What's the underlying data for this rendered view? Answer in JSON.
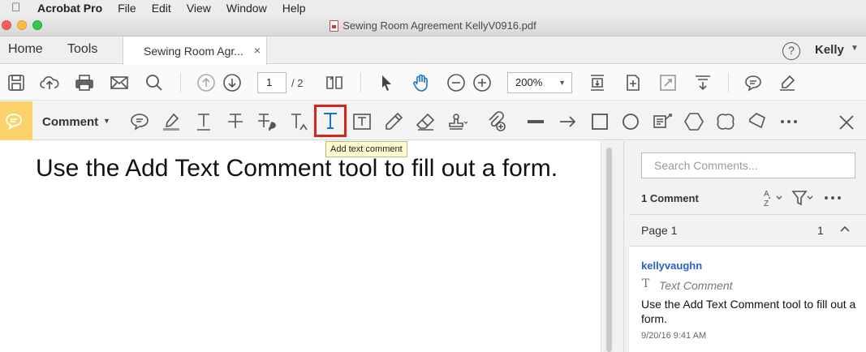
{
  "menubar": {
    "app": "Acrobat Pro",
    "items": [
      "File",
      "Edit",
      "View",
      "Window",
      "Help"
    ]
  },
  "window": {
    "title": "Sewing Room Agreement KellyV0916.pdf"
  },
  "tabs": {
    "home": "Home",
    "tools": "Tools",
    "document": "Sewing Room Agr...",
    "close": "×"
  },
  "user": {
    "name": "Kelly",
    "help": "?"
  },
  "toolbar": {
    "page_current": "1",
    "page_total": "/ 2",
    "zoom": "200%"
  },
  "comment_toolbar": {
    "label": "Comment",
    "active_tool": "Add Text Comment",
    "tooltip": "Add text comment"
  },
  "document": {
    "text": "Use the Add Text Comment tool to fill out a form."
  },
  "panel": {
    "search_placeholder": "Search Comments...",
    "count": "1 Comment",
    "page_label": "Page 1",
    "page_count": "1",
    "comment": {
      "author": "kellyvaughn",
      "type": "Text Comment",
      "body": "Use the Add Text Comment tool to fill out a form.",
      "date": "9/20/16  9:41 AM"
    }
  },
  "colors": {
    "comment_accent": "#fbd36a",
    "selection_border": "#d6261c",
    "active_tool_blue": "#1a73c8",
    "author_link": "#2962c4"
  }
}
